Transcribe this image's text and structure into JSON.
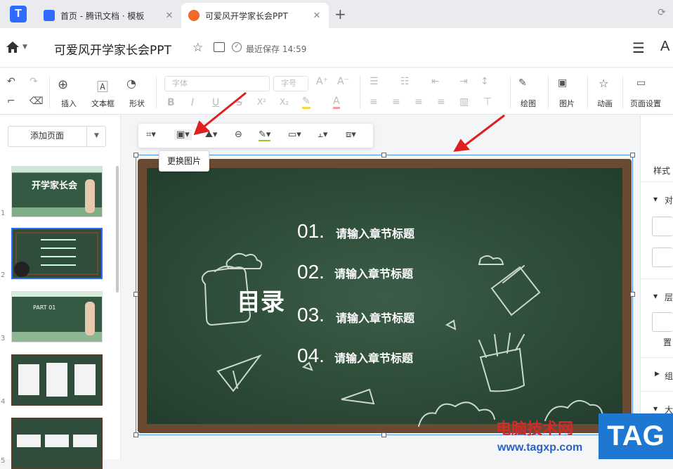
{
  "tabs": [
    {
      "title": "首页 - 腾讯文档 · 模板",
      "close": "✕"
    },
    {
      "title": "可爱风开学家长会PPT",
      "close": "✕"
    }
  ],
  "newtab": "+",
  "applogo": "T",
  "header": {
    "title": "可爱风开学家长会PPT",
    "save_status": "最近保存 14:59",
    "right_icon": "A"
  },
  "toolbar": {
    "insert": "插入",
    "textbox": "文本框",
    "shape": "形状",
    "font": "字体",
    "size": "字号",
    "bold": "B",
    "italic": "I",
    "underline": "U",
    "strike": "S",
    "sup": "X²",
    "sub": "X₂",
    "fontcolor": "A",
    "grow": "A⁺",
    "shrink": "A⁻",
    "draw": "绘图",
    "image": "图片",
    "animation": "动画",
    "page_setup": "页面设置"
  },
  "left_panel": {
    "add_page": "添加页面",
    "slides": [
      "1",
      "2",
      "3",
      "4",
      "5"
    ],
    "thumb1_title": "开学家长会",
    "thumb3_title": "PART 01"
  },
  "tooltip": "更换图片",
  "slide": {
    "title": "目录",
    "chapters": [
      {
        "num": "01.",
        "text": "请输入章节标题"
      },
      {
        "num": "02.",
        "text": "请输入章节标题"
      },
      {
        "num": "03.",
        "text": "请输入章节标题"
      },
      {
        "num": "04.",
        "text": "请输入章节标题"
      }
    ]
  },
  "right_panel": {
    "style_tab": "样式",
    "sections": [
      "对",
      "层",
      "置",
      "组",
      "大"
    ]
  },
  "watermark": {
    "site_name": "电脑技术网",
    "url": "www.tagxp.com",
    "tag": "TAG"
  },
  "colors": {
    "accent": "#2f6bff",
    "board": "#2c4a37",
    "frame": "#6b4a33",
    "selection": "#4a90e2",
    "arrow": "#e02020"
  }
}
